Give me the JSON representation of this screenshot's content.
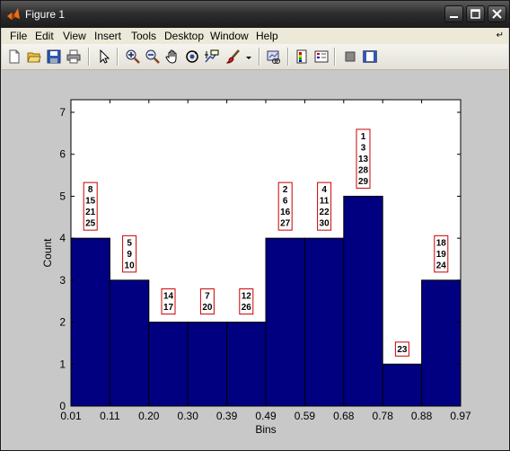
{
  "window": {
    "title": "Figure 1"
  },
  "menubar": {
    "items": [
      "File",
      "Edit",
      "View",
      "Insert",
      "Tools",
      "Desktop",
      "Window",
      "Help"
    ]
  },
  "toolbar": {
    "buttons": [
      "new-figure-icon",
      "open-file-icon",
      "save-icon",
      "print-icon",
      "edit-plot-arrow-icon",
      "zoom-in-icon",
      "zoom-out-icon",
      "pan-hand-icon",
      "rotate-3d-icon",
      "data-cursor-icon",
      "brush-icon",
      "link-plot-icon",
      "colorbar-icon",
      "legend-icon",
      "hide-plot-tools-icon",
      "show-plot-tools-icon"
    ]
  },
  "chart_data": {
    "type": "bar",
    "xlabel": "Bins",
    "ylabel": "Count",
    "ylim": [
      0,
      7.3
    ],
    "xlim": [
      0.01,
      0.97
    ],
    "x_tick_labels": [
      "0.01",
      "0.11",
      "0.20",
      "0.30",
      "0.39",
      "0.49",
      "0.59",
      "0.68",
      "0.78",
      "0.88",
      "0.97"
    ],
    "y_tick_labels": [
      "0",
      "1",
      "2",
      "3",
      "4",
      "5",
      "6",
      "7"
    ],
    "values": [
      4,
      3,
      2,
      2,
      2,
      4,
      4,
      5,
      1,
      3
    ],
    "bar_color": "#000080",
    "label_border_color": "#cc0000",
    "annotations": [
      [
        "8",
        "15",
        "21",
        "25"
      ],
      [
        "5",
        "9",
        "10"
      ],
      [
        "14",
        "17"
      ],
      [
        "7",
        "20"
      ],
      [
        "12",
        "26"
      ],
      [
        "2",
        "6",
        "16",
        "27"
      ],
      [
        "4",
        "11",
        "22",
        "30"
      ],
      [
        "1",
        "3",
        "13",
        "28",
        "29"
      ],
      [
        "23"
      ],
      [
        "18",
        "19",
        "24"
      ]
    ]
  }
}
